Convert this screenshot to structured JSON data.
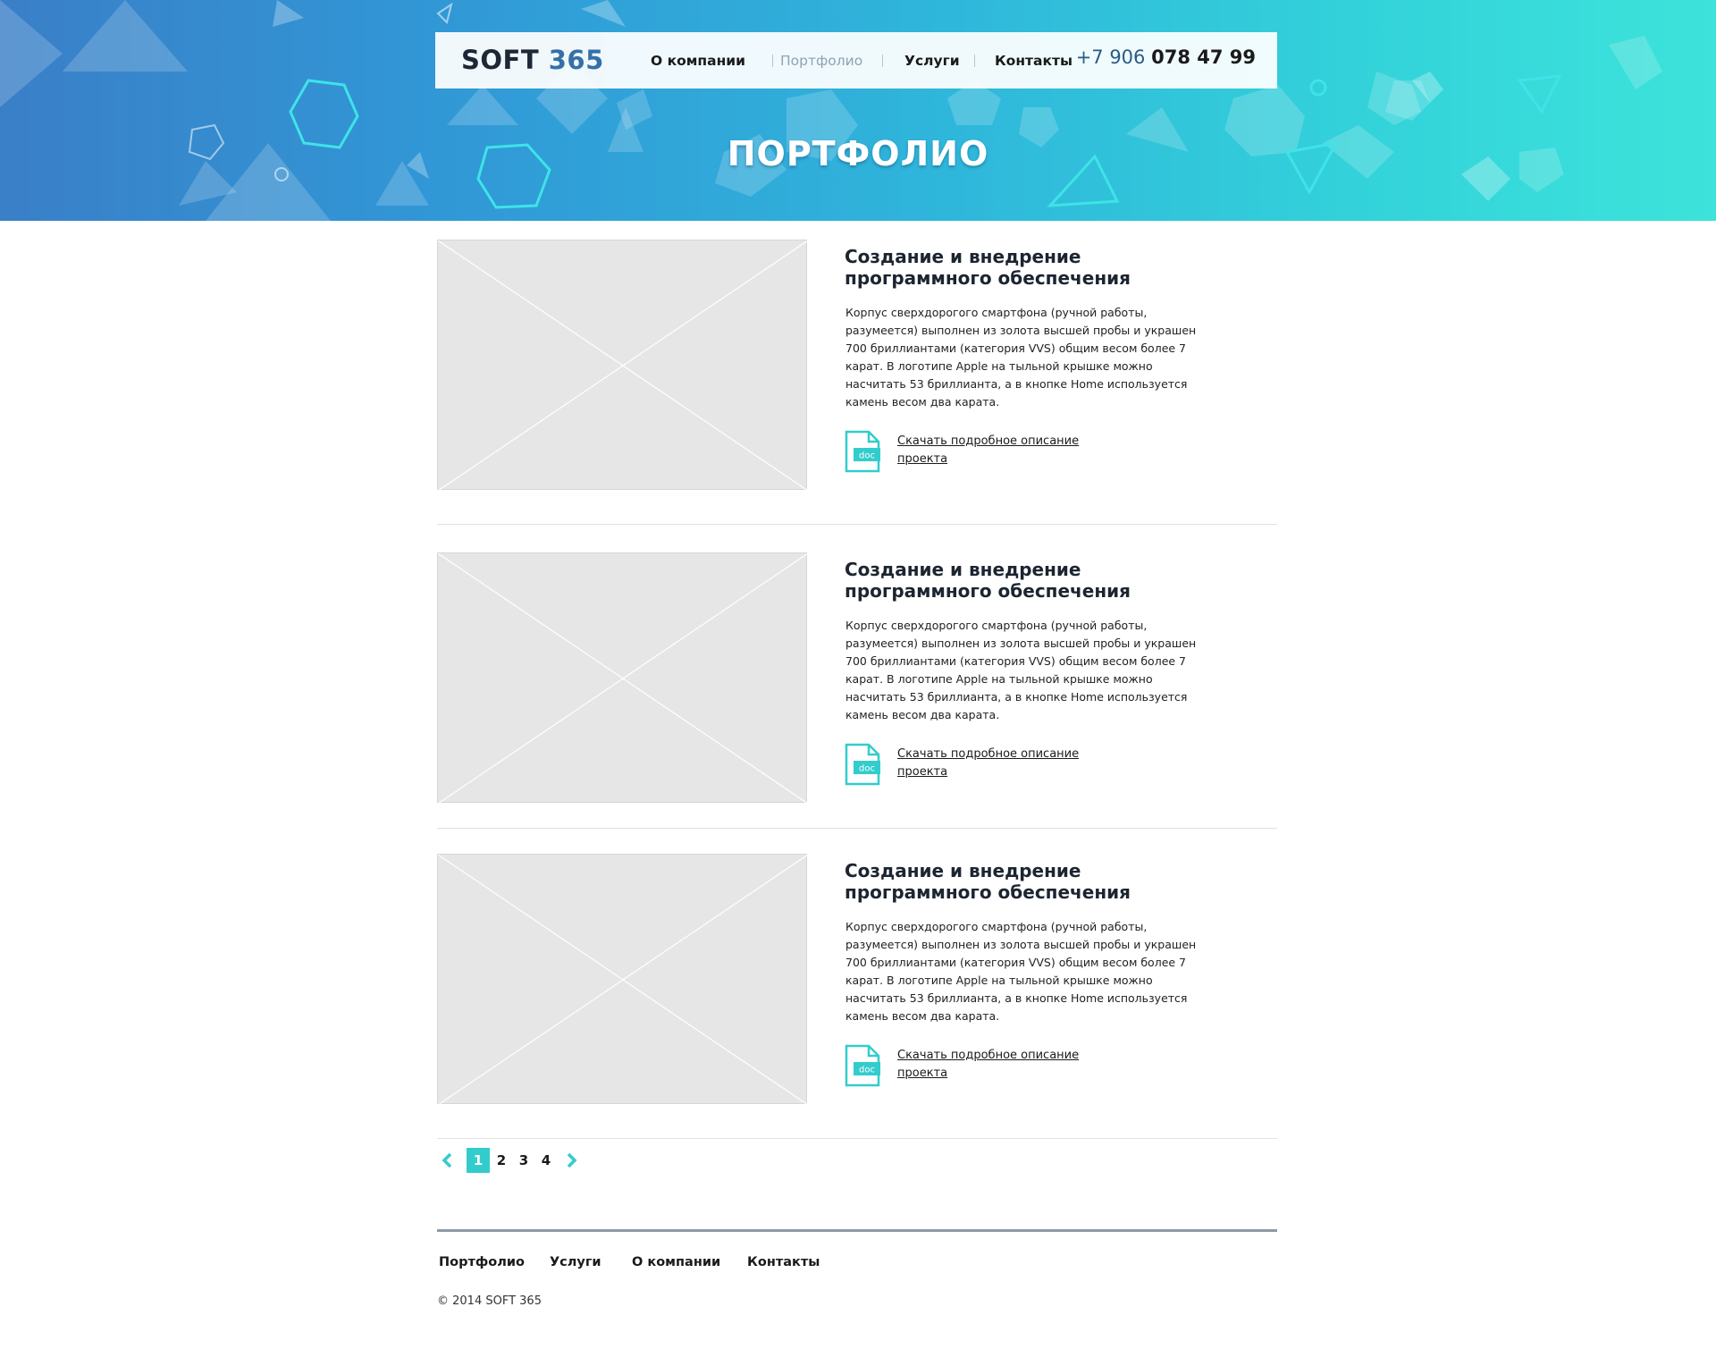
{
  "header": {
    "logo_text": "SOFT",
    "logo_number": "365",
    "nav": [
      {
        "label": "О компании"
      },
      {
        "label": "Портфолио"
      },
      {
        "label": "Услуги"
      },
      {
        "label": "Контакты"
      }
    ],
    "phone_prefix": "+7 906",
    "phone_number": "078 47 99"
  },
  "hero": {
    "title": "ПОРТФОЛИО"
  },
  "items": [
    {
      "title": "Создание и внедрение программного обеспечения",
      "description": "Корпус сверхдорогого смартфона (ручной работы, разумеется) выполнен из золота высшей пробы и украшен 700 бриллиантами (категория VVS) общим весом более 7 карат. В логотипе Apple на тыльной крышке можно насчитать 53 бриллианта, а в кнопке Home используется камень весом два карата.",
      "doc_label": "doc",
      "link": "Скачать подробное описание проекта"
    },
    {
      "title": "Создание и внедрение программного обеспечения",
      "description": "Корпус сверхдорогого смартфона (ручной работы, разумеется) выполнен из золота высшей пробы и украшен 700 бриллиантами (категория VVS) общим весом более 7 карат. В логотипе Apple на тыльной крышке можно насчитать 53 бриллианта, а в кнопке Home используется камень весом два карата.",
      "doc_label": "doc",
      "link": "Скачать подробное описание проекта"
    },
    {
      "title": "Создание и внедрение программного обеспечения",
      "description": "Корпус сверхдорогого смартфона (ручной работы, разумеется) выполнен из золота высшей пробы и украшен 700 бриллиантами (категория VVS) общим весом более 7 карат. В логотипе Apple на тыльной крышке можно насчитать 53 бриллианта, а в кнопке Home используется камень весом два карата.",
      "doc_label": "doc",
      "link": "Скачать подробное описание проекта"
    }
  ],
  "pagination": {
    "pages": [
      "1",
      "2",
      "3",
      "4"
    ],
    "current": "1",
    "prev_icon": "chevron-left-icon",
    "next_icon": "chevron-right-icon"
  },
  "footer": {
    "nav": [
      {
        "label": "Портфолио"
      },
      {
        "label": "Услуги"
      },
      {
        "label": "О компании"
      },
      {
        "label": "Контакты"
      }
    ],
    "copyright": "© 2014 SOFT 365"
  },
  "colors": {
    "accent": "#33cccc",
    "logo_number": "#3570a8",
    "hero_start": "#3a7fc7",
    "hero_end": "#3de3da",
    "nav_active": "#8ea3b5"
  }
}
